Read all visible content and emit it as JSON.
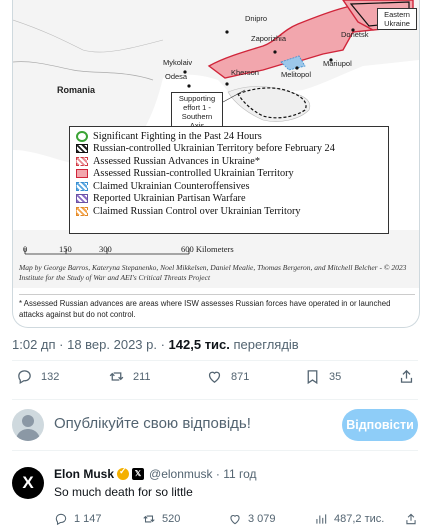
{
  "map": {
    "cities": {
      "dnipro": "Dnipro",
      "zaporizhia": "Zaporizhia",
      "mykolaiv": "Mykolaiv",
      "odesa": "Odesa",
      "kherson": "Kherson",
      "melitopol": "Melitopol",
      "mariupol": "Mariupol",
      "donetsk": "Donetsk"
    },
    "country_label": "Romania",
    "region_label": "Eastern Ukraine",
    "axis_label": "Supporting effort 1 - Southern Axis",
    "legend": [
      {
        "swatch": "circle",
        "label": "Significant Fighting in the Past 24 Hours"
      },
      {
        "swatch": "hatch-black",
        "label": "Russian-controlled Ukrainian Territory before February 24"
      },
      {
        "swatch": "hatch-red",
        "label": "Assessed Russian Advances in Ukraine*"
      },
      {
        "swatch": "red",
        "label": "Assessed Russian-controlled Ukrainian Territory"
      },
      {
        "swatch": "hatch-blue",
        "label": "Claimed Ukrainian Counteroffensives"
      },
      {
        "swatch": "hatch-purple",
        "label": "Reported Ukrainian Partisan Warfare"
      },
      {
        "swatch": "hatch-orange",
        "label": "Claimed Russian Control over Ukrainian Territory"
      }
    ],
    "scale": [
      "0",
      "150",
      "300",
      "600 Kilometers"
    ],
    "credits": "Map by George Barros, Kateryna Stepanenko, Noel Mikkelsen, Daniel Mealie, Thomas Bergeron, and Mitchell Belcher - © 2023 Institute for the Study of War and AEI's Critical Threats Project",
    "note": "* Assessed Russian advances are areas where ISW assesses Russian forces have operated in or launched attacks against but do not control."
  },
  "tweet": {
    "time": "1:02 дп · 18 вер. 2023 р. · ",
    "views_count": "142,5 тис.",
    "views_label": " переглядів",
    "replies": "132",
    "reposts": "211",
    "likes": "871",
    "bookmarks": "35"
  },
  "reply_box": {
    "placeholder": "Опублікуйте свою відповідь!",
    "button": "Відповісти"
  },
  "reply": {
    "avatar_letter": "X",
    "name": "Elon Musk",
    "handle": "@elonmusk · 11 год",
    "text": "So much death for so little",
    "replies": "1 147",
    "reposts": "520",
    "likes": "3 079",
    "views": "487,2 тис."
  },
  "colors": {
    "occupied_red": "#f2a6ad",
    "front_line": "#d0253a",
    "accent": "#1d9bf0",
    "reply_button": "#8ecdf8"
  }
}
